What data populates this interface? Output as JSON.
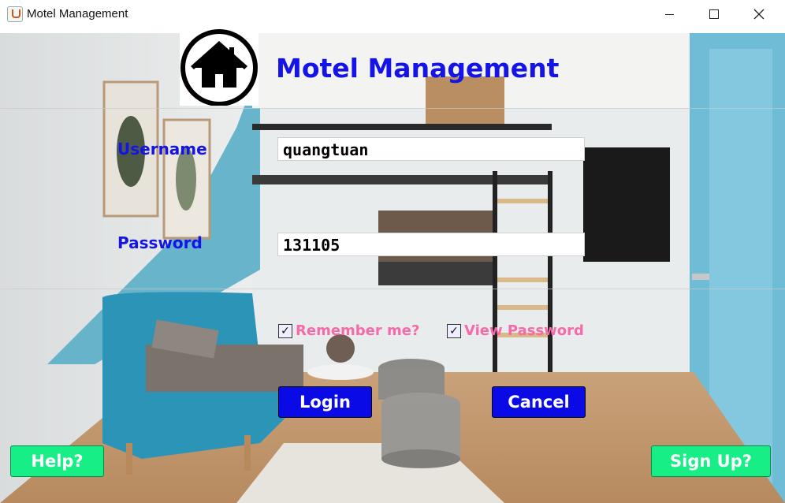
{
  "window": {
    "title": "Motel Management",
    "icon": "java-cup-icon"
  },
  "header": {
    "heading": "Motel Management",
    "logo": "home-icon"
  },
  "form": {
    "username_label": "Username",
    "username_value": "quangtuan",
    "password_label": "Password",
    "password_value": "131105",
    "remember_label": "Remember me?",
    "remember_checked": true,
    "view_password_label": "View Password",
    "view_password_checked": true
  },
  "buttons": {
    "login": "Login",
    "cancel": "Cancel",
    "help": "Help?",
    "sign_up": "Sign Up?"
  },
  "colors": {
    "heading": "#1414e6",
    "checkbox_label": "#f56aa8",
    "primary_button": "#0a0ae6",
    "secondary_button": "#17ee86"
  }
}
